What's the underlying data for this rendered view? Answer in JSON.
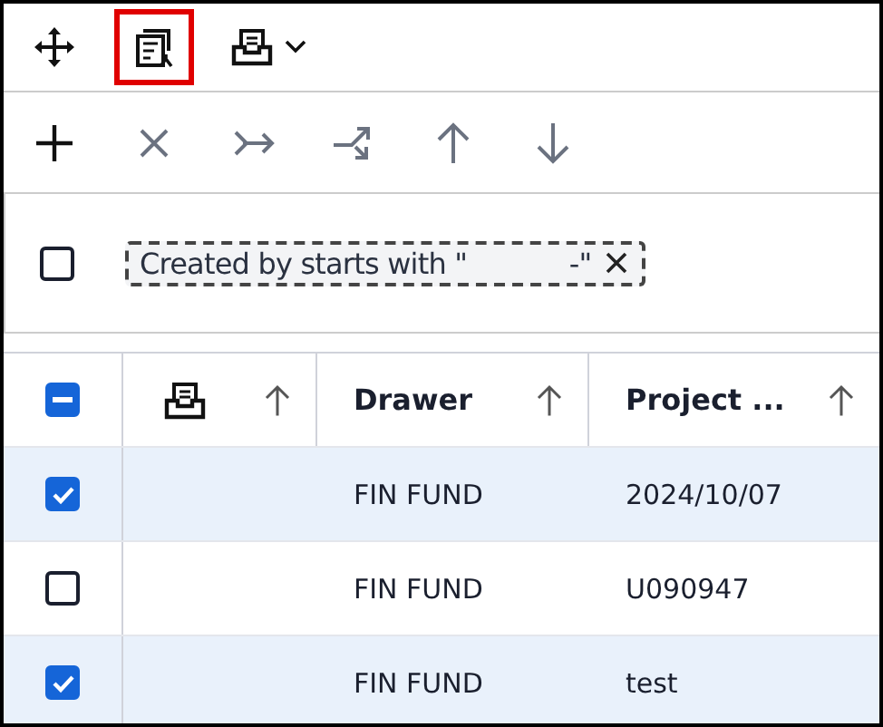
{
  "toolbar": [
    {
      "highlighted": false
    },
    {
      "highlighted": true
    },
    {
      "highlighted": false
    }
  ],
  "actions": [
    {
      "disabled": false
    },
    {
      "disabled": true
    },
    {
      "disabled": true
    },
    {
      "disabled": true
    },
    {
      "disabled": true
    },
    {
      "disabled": true
    }
  ],
  "filter": {
    "checked": false,
    "chip": "Created by starts with \"            -\""
  },
  "table": {
    "select_all_indeterminate": true,
    "columns": [
      {},
      {
        "label": "Drawer"
      },
      {
        "label": "Project ..."
      }
    ],
    "rows": [
      {
        "selected": true,
        "cells": [
          "",
          "FIN FUND",
          "2024/10/07"
        ]
      },
      {
        "selected": false,
        "cells": [
          "",
          "FIN FUND",
          "U090947"
        ]
      },
      {
        "selected": true,
        "cells": [
          "",
          "FIN FUND",
          "test"
        ]
      }
    ]
  }
}
